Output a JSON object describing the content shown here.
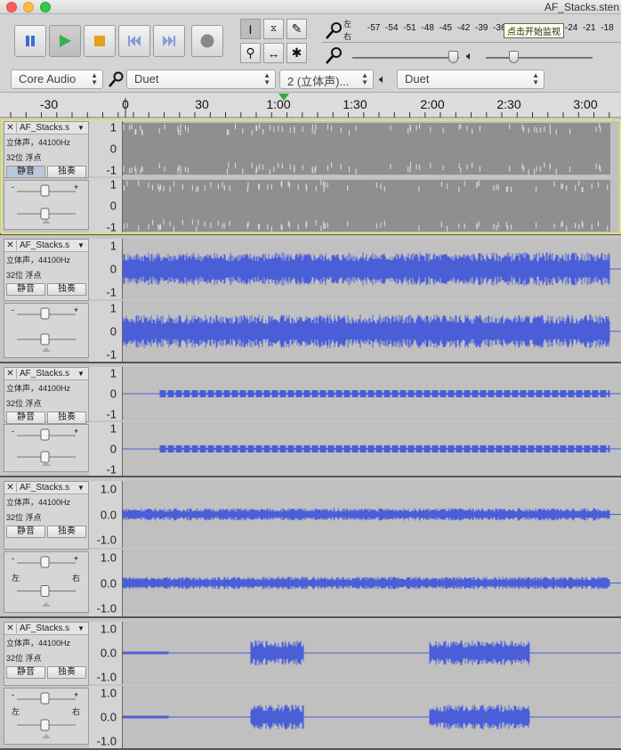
{
  "window": {
    "title": "AF_Stacks.sten"
  },
  "transport": {
    "pause": "pause-icon",
    "play": "play-icon",
    "stop": "stop-icon",
    "skip_start": "skip-start-icon",
    "skip_end": "skip-end-icon",
    "record": "record-icon"
  },
  "meters": {
    "record_left": "左",
    "record_right": "右",
    "ticks": [
      "-57",
      "-54",
      "-51",
      "-48",
      "-45",
      "-42",
      "-39",
      "-36"
    ],
    "ticks_after": [
      "-24",
      "-21",
      "-18"
    ],
    "tooltip": "点击开始监视"
  },
  "device": {
    "host": "Core Audio",
    "input": "Duet",
    "channels": "2 (立体声)...",
    "output": "Duet"
  },
  "ruler": {
    "labels": [
      "-30",
      "0",
      "30",
      "1:00",
      "1:30",
      "2:00",
      "2:30",
      "3:00"
    ]
  },
  "colors": {
    "wave_blue": "#4a5ed8",
    "wave_gray": "#8f8f8f",
    "background": "#c0c0c0"
  },
  "tracks": [
    {
      "name": "AF_Stacks.s",
      "rate": "立体声，44100Hz",
      "format": "32位 浮点",
      "mute": "静音",
      "solo": "独奏",
      "scale": [
        "1",
        "0",
        "-1"
      ],
      "style": "gray",
      "selected": true,
      "pan_left": "",
      "pan_right": ""
    },
    {
      "name": "AF_Stacks.s",
      "rate": "立体声，44100Hz",
      "format": "32位 浮点",
      "mute": "静音",
      "solo": "独奏",
      "scale": [
        "1",
        "0",
        "-1"
      ],
      "style": "dense",
      "selected": false,
      "pan_left": "",
      "pan_right": ""
    },
    {
      "name": "AF_Stacks.s",
      "rate": "立体声，44100Hz",
      "format": "32位 浮点",
      "mute": "静音",
      "solo": "独奏",
      "scale": [
        "1",
        "0",
        "-1"
      ],
      "style": "thin",
      "selected": false,
      "pan_left": "",
      "pan_right": ""
    },
    {
      "name": "AF_Stacks.s",
      "rate": "立体声，44100Hz",
      "format": "32位 浮点",
      "mute": "静音",
      "solo": "独奏",
      "scale": [
        "1.0",
        "0.0",
        "-1.0"
      ],
      "style": "low",
      "selected": false,
      "pan_left": "左",
      "pan_right": "右"
    },
    {
      "name": "AF_Stacks.s",
      "rate": "立体声，44100Hz",
      "format": "32位 浮点",
      "mute": "静音",
      "solo": "独奏",
      "scale": [
        "1.0",
        "0.0",
        "-1.0"
      ],
      "style": "burst",
      "selected": false,
      "pan_left": "左",
      "pan_right": "右"
    }
  ]
}
